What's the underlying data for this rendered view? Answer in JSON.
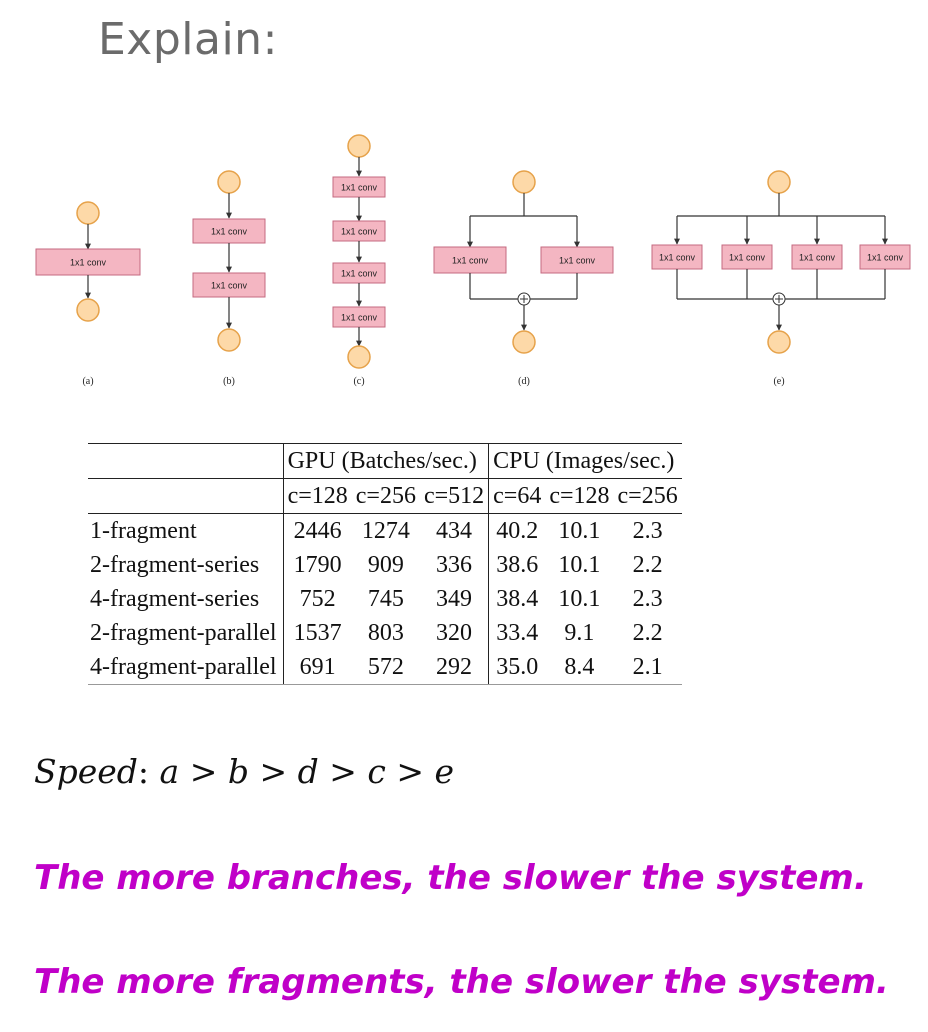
{
  "title": "Explain:",
  "diagram": {
    "box_label": "1x1 conv",
    "captions": [
      "(a)",
      "(b)",
      "(c)",
      "(d)",
      "(e)"
    ],
    "plus_symbol": "+"
  },
  "table": {
    "group_headers": [
      "GPU (Batches/sec.)",
      "CPU (Images/sec.)"
    ],
    "sub_headers": [
      "c=128",
      "c=256",
      "c=512",
      "c=64",
      "c=128",
      "c=256"
    ],
    "rows": [
      {
        "label": "1-fragment",
        "values": [
          "2446",
          "1274",
          "434",
          "40.2",
          "10.1",
          "2.3"
        ]
      },
      {
        "label": "2-fragment-series",
        "values": [
          "1790",
          "909",
          "336",
          "38.6",
          "10.1",
          "2.2"
        ]
      },
      {
        "label": "4-fragment-series",
        "values": [
          "752",
          "745",
          "349",
          "38.4",
          "10.1",
          "2.3"
        ]
      },
      {
        "label": "2-fragment-parallel",
        "values": [
          "1537",
          "803",
          "320",
          "33.4",
          "9.1",
          "2.2"
        ]
      },
      {
        "label": "4-fragment-parallel",
        "values": [
          "691",
          "572",
          "292",
          "35.0",
          "8.4",
          "2.1"
        ]
      }
    ]
  },
  "speed": {
    "label": "Speed",
    "expression": "a > b > d > c > e"
  },
  "notes": [
    "The more branches, the slower the system.",
    "The more fragments, the slower the system."
  ],
  "colors": {
    "box_fill": "#f4b6c2",
    "box_stroke": "#c46a80",
    "node_fill": "#fdd9a8",
    "node_stroke": "#e6a24a",
    "note_color": "#c000c8",
    "title_color": "#6b6b6b"
  }
}
